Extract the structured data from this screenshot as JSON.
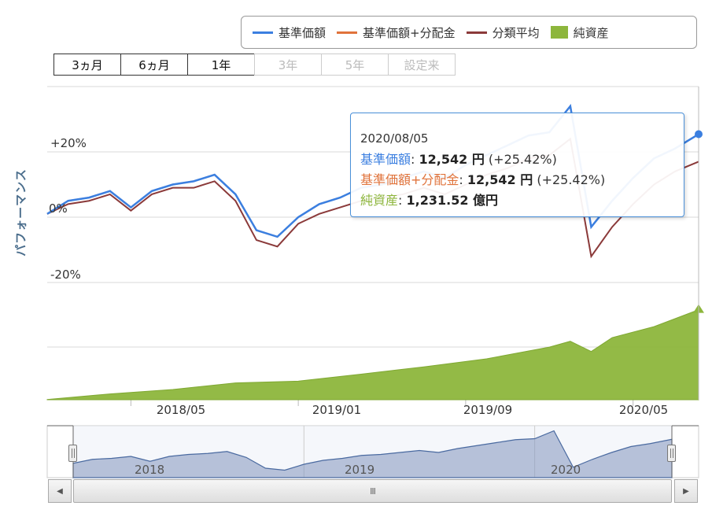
{
  "legend": {
    "items": [
      {
        "label": "基準価額",
        "color": "#3b7fe0",
        "type": "line"
      },
      {
        "label": "基準価額+分配金",
        "color": "#e0733b",
        "type": "line"
      },
      {
        "label": "分類平均",
        "color": "#8b3a3a",
        "type": "line"
      },
      {
        "label": "純資産",
        "color": "#8db63c",
        "type": "area"
      }
    ]
  },
  "range_buttons": [
    {
      "label": "3ヵ月",
      "enabled": true
    },
    {
      "label": "6ヵ月",
      "enabled": true
    },
    {
      "label": "1年",
      "enabled": true
    },
    {
      "label": "3年",
      "enabled": false
    },
    {
      "label": "5年",
      "enabled": false
    },
    {
      "label": "設定来",
      "enabled": false
    }
  ],
  "tooltip": {
    "date": "2020/08/05",
    "nav_label": "基準価額",
    "nav_value": "12,542 円",
    "nav_change": "(+25.42%)",
    "navdiv_label": "基準価額+分配金",
    "navdiv_value": "12,542 円",
    "navdiv_change": "(+25.42%)",
    "assets_label": "純資産",
    "assets_value": "1,231.52 億円"
  },
  "navigator": {
    "year_labels": [
      "2018",
      "2019",
      "2020"
    ]
  },
  "scrollbar": {
    "left_arrow": "◀",
    "right_arrow": "▶",
    "grip": "III"
  },
  "chart_data": {
    "type": "line",
    "ylabel": "パフォーマンス",
    "y_ticks": [
      "+20%",
      "0%",
      "-20%"
    ],
    "x_ticks": [
      "2018/05",
      "2019/01",
      "2019/09",
      "2020/05"
    ],
    "x_range": [
      "2018/01",
      "2020/08/05"
    ],
    "ylim": [
      -20,
      32
    ],
    "grid": true,
    "legend_position": "top-right",
    "series": [
      {
        "name": "基準価額",
        "color": "#3b7fe0",
        "x": [
          "2018/01",
          "2018/02",
          "2018/03",
          "2018/04",
          "2018/05",
          "2018/06",
          "2018/07",
          "2018/08",
          "2018/09",
          "2018/10",
          "2018/11",
          "2018/12",
          "2019/01",
          "2019/02",
          "2019/03",
          "2019/04",
          "2019/05",
          "2019/06",
          "2019/07",
          "2019/08",
          "2019/09",
          "2019/10",
          "2019/11",
          "2019/12",
          "2020/01",
          "2020/02",
          "2020/03",
          "2020/04",
          "2020/05",
          "2020/06",
          "2020/07",
          "2020/08/05"
        ],
        "values": [
          1,
          5,
          6,
          8,
          3,
          8,
          10,
          11,
          13,
          7,
          -4,
          -6,
          0,
          4,
          6,
          9,
          10,
          12,
          14,
          12,
          16,
          19,
          22,
          25,
          26,
          34,
          -3,
          5,
          12,
          18,
          21,
          25.42
        ]
      },
      {
        "name": "基準価額+分配金",
        "color": "#e0733b",
        "x": [
          "2018/01",
          "2018/02",
          "2018/03",
          "2018/04",
          "2018/05",
          "2018/06",
          "2018/07",
          "2018/08",
          "2018/09",
          "2018/10",
          "2018/11",
          "2018/12",
          "2019/01",
          "2019/02",
          "2019/03",
          "2019/04",
          "2019/05",
          "2019/06",
          "2019/07",
          "2019/08",
          "2019/09",
          "2019/10",
          "2019/11",
          "2019/12",
          "2020/01",
          "2020/02",
          "2020/03",
          "2020/04",
          "2020/05",
          "2020/06",
          "2020/07",
          "2020/08/05"
        ],
        "values": [
          1,
          5,
          6,
          8,
          3,
          8,
          10,
          11,
          13,
          7,
          -4,
          -6,
          0,
          4,
          6,
          9,
          10,
          12,
          14,
          12,
          16,
          19,
          22,
          25,
          26,
          34,
          -3,
          5,
          12,
          18,
          21,
          25.42
        ]
      },
      {
        "name": "分類平均",
        "color": "#8b3a3a",
        "x": [
          "2018/01",
          "2018/02",
          "2018/03",
          "2018/04",
          "2018/05",
          "2018/06",
          "2018/07",
          "2018/08",
          "2018/09",
          "2018/10",
          "2018/11",
          "2018/12",
          "2019/01",
          "2019/02",
          "2019/03",
          "2019/04",
          "2019/05",
          "2019/06",
          "2019/07",
          "2019/08",
          "2019/09",
          "2019/10",
          "2019/11",
          "2019/12",
          "2020/01",
          "2020/02",
          "2020/03",
          "2020/04",
          "2020/05",
          "2020/06",
          "2020/07",
          "2020/08/05"
        ],
        "values": [
          1,
          4,
          5,
          7,
          2,
          7,
          9,
          9,
          11,
          5,
          -7,
          -9,
          -2,
          1,
          3,
          5,
          6,
          7,
          9,
          7,
          10,
          13,
          15,
          18,
          19,
          24,
          -12,
          -3,
          4,
          10,
          14,
          17
        ]
      }
    ],
    "area_series": {
      "name": "純資産",
      "color": "#8db63c",
      "x": [
        "2018/01",
        "2018/04",
        "2018/07",
        "2018/10",
        "2019/01",
        "2019/04",
        "2019/07",
        "2019/10",
        "2020/01",
        "2020/02",
        "2020/03",
        "2020/04",
        "2020/06",
        "2020/08/05"
      ],
      "values": [
        3,
        80,
        140,
        230,
        255,
        350,
        450,
        560,
        720,
        800,
        660,
        850,
        1000,
        1231.52
      ],
      "ylim": [
        0,
        1400
      ]
    }
  }
}
